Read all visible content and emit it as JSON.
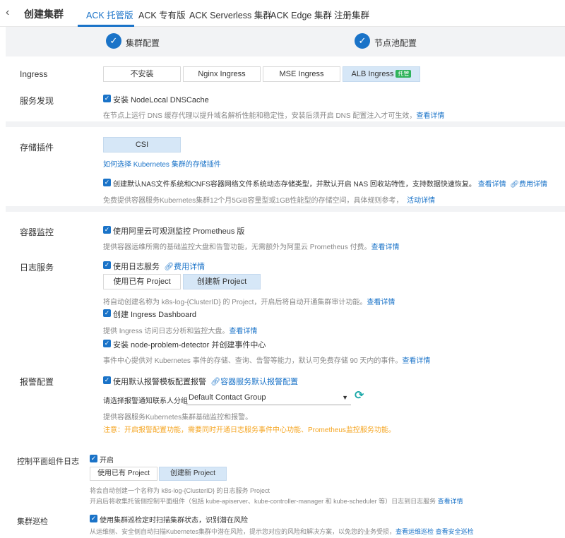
{
  "header": {
    "back_icon": "chevron-left-icon",
    "title": "创建集群",
    "tabs": [
      "ACK 托管版",
      "ACK 专有版",
      "ACK Serverless 集群",
      "ACK Edge 集群",
      "注册集群"
    ]
  },
  "steps": [
    "集群配置",
    "节点池配置"
  ],
  "ingress": {
    "label": "Ingress",
    "options": [
      "不安装",
      "Nginx Ingress",
      "MSE Ingress",
      "ALB Ingress"
    ],
    "badge": "托管",
    "selected": "ALB Ingress"
  },
  "service_discovery": {
    "label": "服务发现",
    "checkbox": "安装 NodeLocal DNSCache",
    "desc": "在节点上运行 DNS 缓存代理以提升域名解析性能和稳定性，安装后须开启 DNS 配置注入才可生效，",
    "link": "查看详情"
  },
  "storage": {
    "label": "存储插件",
    "option": "CSI",
    "how_link": "如何选择 Kubernetes 集群的存储插件",
    "checkbox": "创建默认NAS文件系统和CNFS容器网络文件系统动态存储类型，并默认开启 NAS 回收站特性，支持数据快速恢复。",
    "link_details": "查看详情",
    "link_fee": "费用详情",
    "desc": "免费提供容器服务Kubernetes集群12个月5GiB容量型或1GB性能型的存储空间，具体规则参考，",
    "link_activity": "活动详情"
  },
  "monitoring": {
    "label": "容器监控",
    "checkbox": "使用阿里云可观测监控 Prometheus 版",
    "desc": "提供容器运维所需的基础监控大盘和告警功能，无需额外为阿里云 Prometheus 付费。",
    "link": "查看详情"
  },
  "logging": {
    "label": "日志服务",
    "checkbox": "使用日志服务",
    "fee_link": "费用详情",
    "options": [
      "使用已有 Project",
      "创建新 Project"
    ],
    "desc": "将自动创建名称为 k8s-log-{ClusterID} 的 Project，开启后将自动开通集群审计功能。",
    "link": "查看详情",
    "ingress_checkbox": "创建 Ingress Dashboard",
    "ingress_desc": "提供 Ingress 访问日志分析和监控大盘。",
    "ingress_link": "查看详情",
    "npd_checkbox": "安装 node-problem-detector 并创建事件中心",
    "npd_desc": "事件中心提供对 Kubernetes 事件的存储、查询、告警等能力，默认可免费存储 90 天内的事件。",
    "npd_link": "查看详情"
  },
  "alert": {
    "label": "报警配置",
    "checkbox": "使用默认报警模板配置报警",
    "link": "容器服务默认报警配置",
    "contact_label": "请选择报警通知联系人分组",
    "contact_value": "Default Contact Group",
    "desc": "提供容器服务Kubernetes集群基础监控和报警。",
    "warning": "注意：开启报警配置功能，需要同时开通日志服务事件中心功能、Prometheus监控服务功能。"
  },
  "control_plane_log": {
    "label": "控制平面组件日志",
    "checkbox": "开启",
    "options": [
      "使用已有 Project",
      "创建新 Project"
    ],
    "desc1": "将会自动创建一个名称为 k8s-log-{ClusterID} 的日志服务 Project",
    "desc2": "开启后将收集托管侧控制平面组件（包括 kube-apiserver、kube-controller-manager 和 kube-scheduler 等）日志到日志服务",
    "link": "查看详情"
  },
  "inspection": {
    "label": "集群巡检",
    "checkbox": "使用集群巡检定时扫描集群状态，识别潜在风险",
    "desc": "从运维侧、安全侧自动扫描Kubernetes集群中潜在风险，提示您对应的风险和解决方案，以免您的业务受损，",
    "link1": "查看运维巡检",
    "link2": "查看安全巡检"
  }
}
